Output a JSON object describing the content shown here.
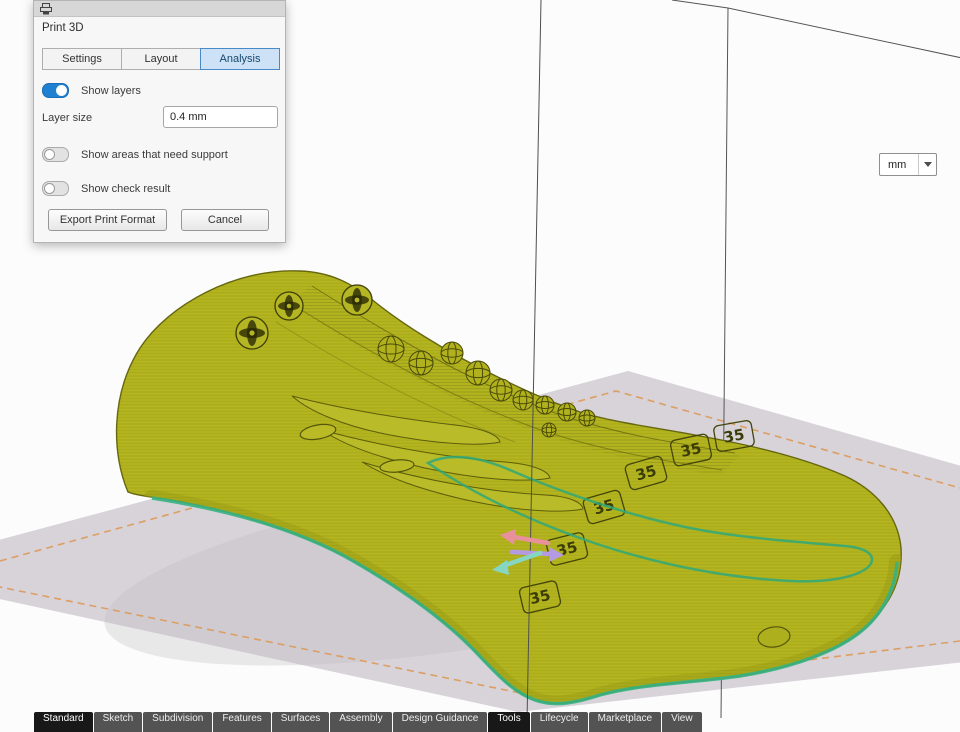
{
  "dialog": {
    "title": "Print 3D",
    "tabs": [
      {
        "label": "Settings",
        "active": false
      },
      {
        "label": "Layout",
        "active": false
      },
      {
        "label": "Analysis",
        "active": true
      }
    ],
    "show_layers": {
      "label": "Show layers",
      "on": true
    },
    "layer_size": {
      "label": "Layer size",
      "value": "0.4 mm"
    },
    "show_support": {
      "label": "Show areas that need support",
      "on": false
    },
    "show_check": {
      "label": "Show check result",
      "on": false
    },
    "export_button": "Export Print Format",
    "cancel_button": "Cancel"
  },
  "units_dropdown": {
    "value": "mm"
  },
  "bottom_tabs": [
    {
      "label": "Standard",
      "active": true
    },
    {
      "label": "Sketch",
      "active": false
    },
    {
      "label": "Subdivision",
      "active": false
    },
    {
      "label": "Features",
      "active": false
    },
    {
      "label": "Surfaces",
      "active": false
    },
    {
      "label": "Assembly",
      "active": false
    },
    {
      "label": "Design Guidance",
      "active": false
    },
    {
      "label": "Tools",
      "active": true
    },
    {
      "label": "Lifecycle",
      "active": false
    },
    {
      "label": "Marketplace",
      "active": false
    },
    {
      "label": "View",
      "active": false
    }
  ],
  "scene": {
    "size_marker_text": "35",
    "colors": {
      "model": "#b3b41e",
      "model_outline": "#66670f",
      "bed": "#d7d3d8",
      "bed_dashed_border": "#dd9e63",
      "accent_teal": "#33ad7e",
      "gizmo_pink": "#e8919d",
      "gizmo_purple": "#b49ae2",
      "gizmo_teal": "#86d6c2"
    }
  }
}
